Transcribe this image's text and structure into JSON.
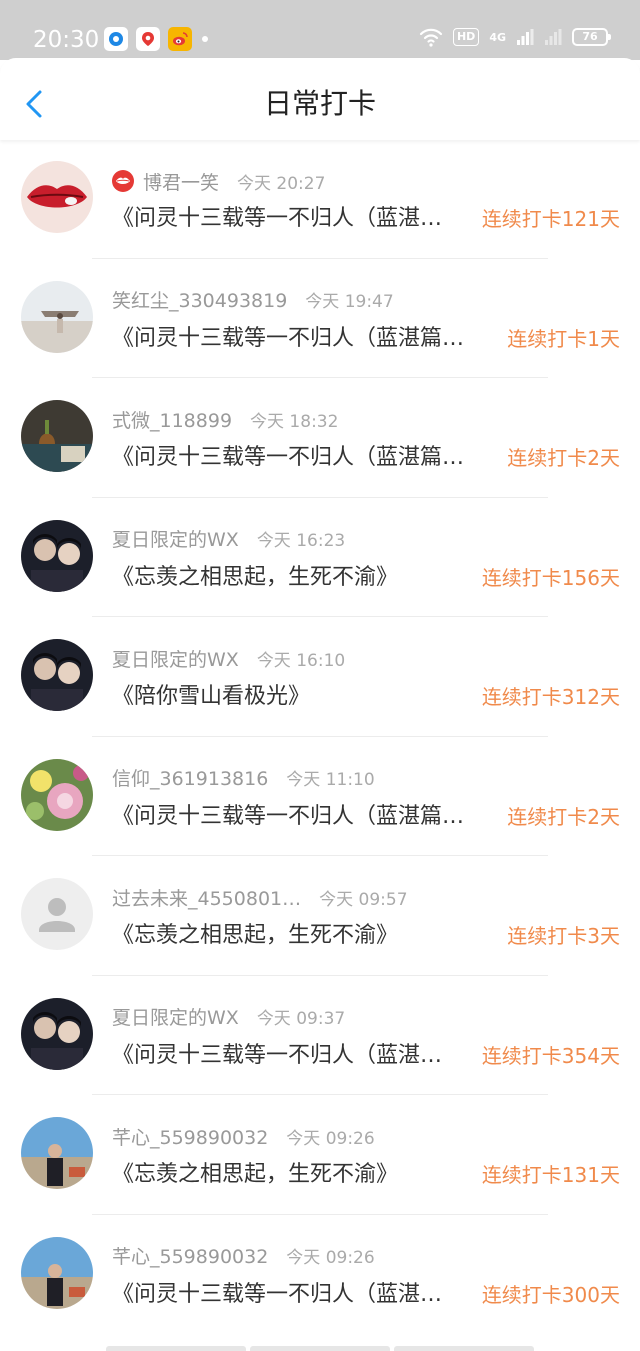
{
  "status_bar": {
    "time": "20:30",
    "network_badge": "HD",
    "network_type": "4G",
    "battery": "76"
  },
  "header": {
    "title": "日常打卡"
  },
  "colors": {
    "accent": "#f08a4b",
    "back_arrow": "#2196f3"
  },
  "entries": [
    {
      "user": "博君一笑",
      "time": "今天 20:27",
      "book": "《问灵十三载等一不归人（蓝湛…",
      "streak": "连续打卡121天",
      "avatar": "lips-photo",
      "badge": "lips-icon"
    },
    {
      "user": "笑红尘_330493819",
      "time": "今天 19:47",
      "book": "《问灵十三载等一不归人（蓝湛篇…",
      "streak": "连续打卡1天",
      "avatar": "beach-photo"
    },
    {
      "user": "式微_118899",
      "time": "今天 18:32",
      "book": "《问灵十三载等一不归人（蓝湛篇…",
      "streak": "连续打卡2天",
      "avatar": "still-life-photo"
    },
    {
      "user": "夏日限定的WX",
      "time": "今天 16:23",
      "book": "《忘羡之相思起，生死不渝》",
      "streak": "连续打卡156天",
      "avatar": "couple-photo"
    },
    {
      "user": "夏日限定的WX",
      "time": "今天 16:10",
      "book": "《陪你雪山看极光》",
      "streak": "连续打卡312天",
      "avatar": "couple-photo"
    },
    {
      "user": "信仰_361913816",
      "time": "今天 11:10",
      "book": "《问灵十三载等一不归人（蓝湛篇…",
      "streak": "连续打卡2天",
      "avatar": "flowers-photo"
    },
    {
      "user": "过去未来_4550801…",
      "time": "今天 09:57",
      "book": "《忘羡之相思起，生死不渝》",
      "streak": "连续打卡3天",
      "avatar": "default-user-icon"
    },
    {
      "user": "夏日限定的WX",
      "time": "今天 09:37",
      "book": "《问灵十三载等一不归人（蓝湛…",
      "streak": "连续打卡354天",
      "avatar": "couple-photo"
    },
    {
      "user": "芊心_559890032",
      "time": "今天 09:26",
      "book": "《忘羡之相思起，生死不渝》",
      "streak": "连续打卡131天",
      "avatar": "seaside-portrait"
    },
    {
      "user": "芊心_559890032",
      "time": "今天 09:26",
      "book": "《问灵十三载等一不归人（蓝湛…",
      "streak": "连续打卡300天",
      "avatar": "seaside-portrait"
    }
  ]
}
